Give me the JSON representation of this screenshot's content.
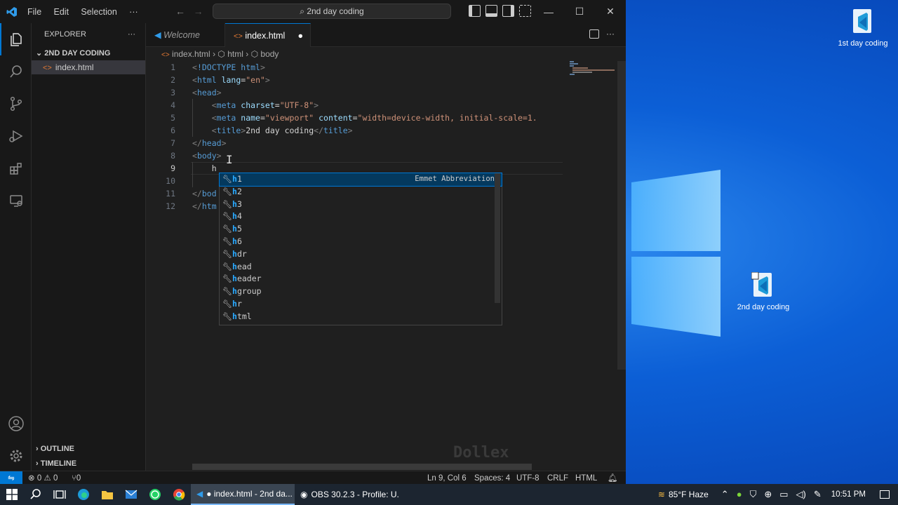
{
  "vscode": {
    "menu": [
      "File",
      "Edit",
      "Selection",
      "···"
    ],
    "command_center": "2nd day coding",
    "explorer": {
      "title": "EXPLORER",
      "more": "···",
      "folder": "2ND DAY CODING",
      "file": "index.html",
      "file_icon": "<>",
      "outline": "OUTLINE",
      "timeline": "TIMELINE"
    },
    "tabs": [
      {
        "label": "Welcome"
      },
      {
        "label": "index.html"
      }
    ],
    "breadcrumb": {
      "file": "index.html",
      "html": "html",
      "body": "body"
    },
    "code": [
      {
        "n": "1",
        "parts": [
          [
            "tg",
            "<"
          ],
          [
            "tn",
            "!DOCTYPE"
          ],
          [
            "tx",
            " "
          ],
          [
            "tn",
            "html"
          ],
          [
            "tg",
            ">"
          ]
        ]
      },
      {
        "n": "2",
        "parts": [
          [
            "tg",
            "<"
          ],
          [
            "tn",
            "html"
          ],
          [
            "tx",
            " "
          ],
          [
            "at",
            "lang"
          ],
          [
            "tx",
            "="
          ],
          [
            "av",
            "\"en\""
          ],
          [
            "tg",
            ">"
          ]
        ]
      },
      {
        "n": "3",
        "parts": [
          [
            "tg",
            "<"
          ],
          [
            "tn",
            "head"
          ],
          [
            "tg",
            ">"
          ]
        ]
      },
      {
        "n": "4",
        "parts": [
          [
            "tx",
            "    "
          ],
          [
            "tg",
            "<"
          ],
          [
            "tn",
            "meta"
          ],
          [
            "tx",
            " "
          ],
          [
            "at",
            "charset"
          ],
          [
            "tx",
            "="
          ],
          [
            "av",
            "\"UTF-8\""
          ],
          [
            "tg",
            ">"
          ]
        ]
      },
      {
        "n": "5",
        "parts": [
          [
            "tx",
            "    "
          ],
          [
            "tg",
            "<"
          ],
          [
            "tn",
            "meta"
          ],
          [
            "tx",
            " "
          ],
          [
            "at",
            "name"
          ],
          [
            "tx",
            "="
          ],
          [
            "av",
            "\"viewport\""
          ],
          [
            "tx",
            " "
          ],
          [
            "at",
            "content"
          ],
          [
            "tx",
            "="
          ],
          [
            "av",
            "\"width=device-width, initial-scale=1."
          ]
        ]
      },
      {
        "n": "6",
        "parts": [
          [
            "tx",
            "    "
          ],
          [
            "tg",
            "<"
          ],
          [
            "tn",
            "title"
          ],
          [
            "tg",
            ">"
          ],
          [
            "tx",
            "2nd day coding"
          ],
          [
            "tg",
            "</"
          ],
          [
            "tn",
            "title"
          ],
          [
            "tg",
            ">"
          ]
        ]
      },
      {
        "n": "7",
        "parts": [
          [
            "tg",
            "</"
          ],
          [
            "tn",
            "head"
          ],
          [
            "tg",
            ">"
          ]
        ]
      },
      {
        "n": "8",
        "parts": [
          [
            "tg",
            "<"
          ],
          [
            "tn",
            "body"
          ],
          [
            "tg",
            ">"
          ]
        ]
      },
      {
        "n": "9",
        "parts": [
          [
            "tx",
            "    h"
          ]
        ]
      },
      {
        "n": "10",
        "parts": []
      },
      {
        "n": "11",
        "parts": [
          [
            "tg",
            "</"
          ],
          [
            "tn",
            "bod"
          ]
        ]
      },
      {
        "n": "12",
        "parts": [
          [
            "tg",
            "</"
          ],
          [
            "tn",
            "htm"
          ]
        ]
      }
    ],
    "suggestions": [
      {
        "label": "h1",
        "detail": "Emmet Abbreviation"
      },
      {
        "label": "h2"
      },
      {
        "label": "h3"
      },
      {
        "label": "h4"
      },
      {
        "label": "h5"
      },
      {
        "label": "h6"
      },
      {
        "label": "hdr"
      },
      {
        "label": "head"
      },
      {
        "label": "header"
      },
      {
        "label": "hgroup"
      },
      {
        "label": "hr"
      },
      {
        "label": "html"
      }
    ],
    "watermark": "Dollex",
    "status": {
      "errors": "0",
      "warnings": "0",
      "ports": "0",
      "position": "Ln 9, Col 6",
      "spaces": "Spaces: 4",
      "encoding": "UTF-8",
      "eol": "CRLF",
      "language": "HTML"
    }
  },
  "desktop": {
    "icons": [
      {
        "label": "1st day coding"
      },
      {
        "label": "2nd day coding"
      }
    ]
  },
  "taskbar": {
    "apps": [
      {
        "label": "● index.html - 2nd da..."
      },
      {
        "label": "OBS 30.2.3 - Profile: U..."
      }
    ],
    "weather": "85°F  Haze",
    "time": "10:51 PM"
  },
  "colors": {
    "accent": "#0078d4",
    "editor_bg": "#1f1f1f",
    "chrome_bg": "#181818",
    "desktop_blue": "#0c5fd6"
  }
}
